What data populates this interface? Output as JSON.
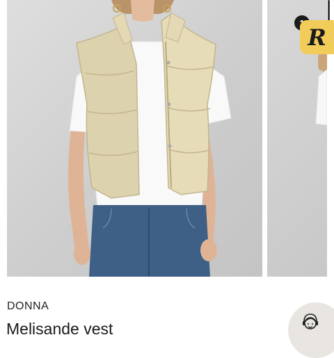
{
  "product": {
    "brand": "DONNA",
    "title": "Melisande vest"
  },
  "gallery": {
    "main_image": "product-photo-vest-front",
    "next_image": "product-photo-vest-side"
  },
  "floating_action": {
    "icon": "brand-logo-R",
    "letter": "R",
    "badge_count": "1",
    "color": "#f2cc59"
  },
  "assistant": {
    "icon": "support-agent-icon"
  }
}
